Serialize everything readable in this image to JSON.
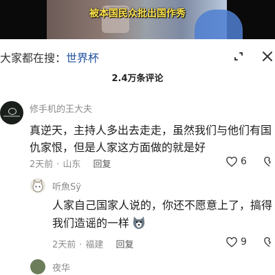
{
  "video": {
    "caption": "被本国民众批出国作秀"
  },
  "search": {
    "prefix": "大家都在搜：",
    "keyword": "世界杯",
    "icons": [
      "expand-icon",
      "close-icon"
    ]
  },
  "comments_header": {
    "count_label": "2.4万条评论"
  },
  "comments": [
    {
      "author": "修手机的王大夫",
      "lines": [
        "真逆天，主持人多出去走走，虽然我们与他们有国",
        "仇家恨，但是人家这方面做的就是好"
      ],
      "time": "2天前",
      "location": "山东",
      "reply_label": "回复",
      "likes": "6"
    },
    {
      "author": "听魚Sÿ",
      "lines": [
        "人家自己国家人说的，你还不愿意上了，搞得",
        "我们造谣的一样"
      ],
      "time": "2天前",
      "location": "福建",
      "reply_label": "回复",
      "likes": "9"
    },
    {
      "author": "夜华"
    }
  ],
  "colors": {
    "caption": "#ffe34a",
    "keyword": "#1f4e9c",
    "meta": "#8c8c8c"
  }
}
